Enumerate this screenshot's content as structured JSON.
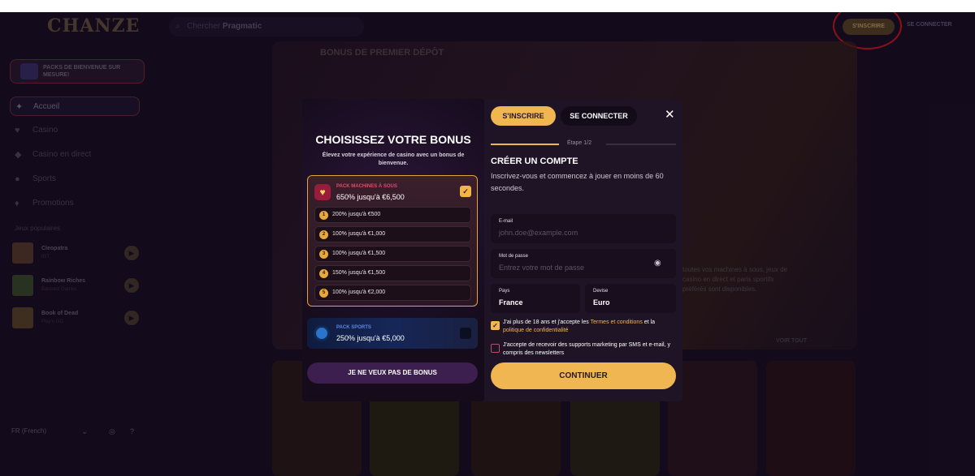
{
  "header": {
    "logo": "CHANZE",
    "search_placeholder": "Chercher",
    "search_term": "Pragmatic",
    "register_label": "S'INSCRIRE",
    "login_label": "SE CONNECTER"
  },
  "sidebar": {
    "promo_label": "PACKS DE BIENVENUE SUR MESURE!",
    "nav": [
      {
        "label": "Accueil",
        "icon": "home-icon"
      },
      {
        "label": "Casino",
        "icon": "cherry-icon"
      },
      {
        "label": "Casino en direct",
        "icon": "live-casino-icon"
      },
      {
        "label": "Sports",
        "icon": "football-icon"
      },
      {
        "label": "Promotions",
        "icon": "diamond-icon"
      }
    ],
    "popular_heading": "Jeux populaires",
    "games": [
      {
        "name": "Cleopatra",
        "provider": "IGT"
      },
      {
        "name": "Rainbow Riches",
        "provider": "Barcrest Games"
      },
      {
        "name": "Book of Dead",
        "provider": "Play'n GO"
      }
    ],
    "language": "FR (French)"
  },
  "background": {
    "banner_title": "BONUS DE PREMIER DÉPÔT",
    "banner_text": "toutes vos machines à sous, jeux de casino en direct et paris sportifs préférés sont disponibles.",
    "view_all": "VOIR TOUT"
  },
  "bonus_panel": {
    "title": "CHOISISSEZ VOTRE BONUS",
    "subtitle": "Élevez votre expérience de casino avec un bonus de bienvenue.",
    "slots_pack": {
      "name": "PACK MACHINES À SOUS",
      "amount": "650% jusqu'à €6,500",
      "tiers": [
        {
          "num": "1",
          "label": "200% jusqu'à €500"
        },
        {
          "num": "2",
          "label": "100% jusqu'à €1,000"
        },
        {
          "num": "3",
          "label": "100% jusqu'à €1,500"
        },
        {
          "num": "4",
          "label": "150% jusqu'à €1,500"
        },
        {
          "num": "5",
          "label": "100% jusqu'à €2,000"
        }
      ]
    },
    "sports_pack": {
      "name": "PACK SPORTS",
      "amount": "250% jusqu'à €5,000"
    },
    "no_bonus_label": "JE NE VEUX PAS DE BONUS"
  },
  "register_panel": {
    "tab_register": "S'INSCRIRE",
    "tab_login": "SE CONNECTER",
    "close_symbol": "✕",
    "step": "Étape 1/2",
    "title": "CRÉER UN COMPTE",
    "subtitle": "Inscrivez-vous et commencez à jouer en moins de 60 secondes.",
    "email_label": "E-mail",
    "email_placeholder": "john.doe@example.com",
    "password_label": "Mot de passe",
    "password_placeholder": "Entrez votre mot de passe",
    "country_label": "Pays",
    "country_value": "France",
    "currency_label": "Devise",
    "currency_value": "Euro",
    "terms_prefix": "J'ai plus de 18 ans et j'accepte les ",
    "terms_link": "Termes et conditions",
    "terms_mid": " et la ",
    "privacy_link": "politique de confidentialité",
    "marketing_text": "J'accepte de recevoir des supports marketing par SMS et e-mail, y compris des newsletters",
    "continue_label": "CONTINUER"
  },
  "colors": {
    "accent": "#f0b652",
    "background": "#1a0f24",
    "panel": "#1f1426",
    "highlight_circle": "#d8151e"
  }
}
